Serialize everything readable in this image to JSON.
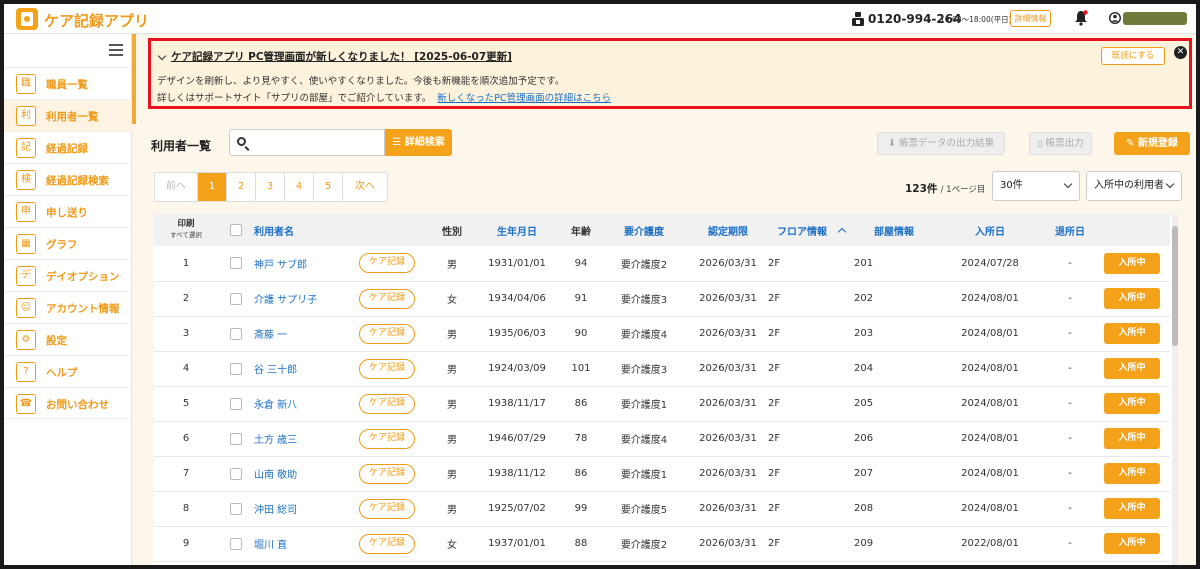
{
  "app": {
    "title": "ケア記録アプリ",
    "accent_color": "#f5a21b",
    "alert_border_color": "#e6131e"
  },
  "header": {
    "phone": "0120-994-264",
    "hours": "10:00〜18:00(平日)",
    "detail_button": "詳細情報",
    "phone_icon": "phone-icon",
    "bell_icon": "bell-icon",
    "user_icon": "user-icon"
  },
  "sidebar": {
    "items": [
      {
        "label": "職員一覧",
        "icon": "staff-icon",
        "glyph": "職"
      },
      {
        "label": "利用者一覧",
        "icon": "users-icon",
        "glyph": "利"
      },
      {
        "label": "経過記録",
        "icon": "clipboard-icon",
        "glyph": "記"
      },
      {
        "label": "経過記録検索",
        "icon": "record-search-icon",
        "glyph": "検"
      },
      {
        "label": "申し送り",
        "icon": "handover-icon",
        "glyph": "申"
      },
      {
        "label": "グラフ",
        "icon": "graph-icon",
        "glyph": "▦"
      },
      {
        "label": "デイオプション",
        "icon": "day-option-icon",
        "glyph": "デ"
      },
      {
        "label": "アカウント情報",
        "icon": "account-icon",
        "glyph": "☺"
      },
      {
        "label": "設定",
        "icon": "gear-icon",
        "glyph": "⚙"
      },
      {
        "label": "ヘルプ",
        "icon": "help-icon",
        "glyph": "?"
      },
      {
        "label": "お問い合わせ",
        "icon": "contact-icon",
        "glyph": "☎"
      }
    ]
  },
  "notice": {
    "title": "ケア記録アプリ PC管理画面が新しくなりました！ [2025-06-07更新]",
    "body1": "デザインを刷新し、より見やすく、使いやすくなりました。今後も新機能を順次追加予定です。",
    "body2": "詳しくはサポートサイト「サプリの部屋」でご紹介しています。",
    "link": "新しくなったPC管理画面の詳細はこちら",
    "read_button": "既読にする"
  },
  "main": {
    "list_title": "利用者一覧",
    "search_value": "",
    "advanced_search": "詳細検索",
    "export_results": "帳票データの出力結果",
    "output_button": "帳票出力",
    "new_button": "新規登録"
  },
  "pagination": {
    "prev": "前へ",
    "pages": [
      "1",
      "2",
      "3",
      "4",
      "5"
    ],
    "next": "次へ",
    "count": "123件",
    "page_info": "/ 1ページ目",
    "per_page": "30件",
    "status_filter": "入所中の利用者"
  },
  "table": {
    "headers": {
      "print": "印刷",
      "select_all": "すべて選択",
      "name": "利用者名",
      "gender": "性別",
      "birthdate": "生年月日",
      "age": "年齢",
      "care_level": "要介護度",
      "cert_period": "認定期限",
      "floor": "フロア情報",
      "room": "部屋情報",
      "admission": "入所日",
      "discharge": "退所日"
    },
    "care_button": "ケア記録",
    "rows": [
      {
        "no": "1",
        "name": "神戸 サブ郎",
        "gender": "男",
        "birth": "1931/01/01",
        "age": "94",
        "care": "要介護度2",
        "cert": "2026/03/31",
        "floor": "2F",
        "room": "201",
        "admit": "2024/07/28",
        "discharge": "-",
        "status": "入所中"
      },
      {
        "no": "2",
        "name": "介護 サプリ子",
        "gender": "女",
        "birth": "1934/04/06",
        "age": "91",
        "care": "要介護度3",
        "cert": "2026/03/31",
        "floor": "2F",
        "room": "202",
        "admit": "2024/08/01",
        "discharge": "-",
        "status": "入所中"
      },
      {
        "no": "3",
        "name": "斎藤 一",
        "gender": "男",
        "birth": "1935/06/03",
        "age": "90",
        "care": "要介護度4",
        "cert": "2026/03/31",
        "floor": "2F",
        "room": "203",
        "admit": "2024/08/01",
        "discharge": "-",
        "status": "入所中"
      },
      {
        "no": "4",
        "name": "谷 三十郎",
        "gender": "男",
        "birth": "1924/03/09",
        "age": "101",
        "care": "要介護度3",
        "cert": "2026/03/31",
        "floor": "2F",
        "room": "204",
        "admit": "2024/08/01",
        "discharge": "-",
        "status": "入所中"
      },
      {
        "no": "5",
        "name": "永倉 新八",
        "gender": "男",
        "birth": "1938/11/17",
        "age": "86",
        "care": "要介護度1",
        "cert": "2026/03/31",
        "floor": "2F",
        "room": "205",
        "admit": "2024/08/01",
        "discharge": "-",
        "status": "入所中"
      },
      {
        "no": "6",
        "name": "土方 歳三",
        "gender": "男",
        "birth": "1946/07/29",
        "age": "78",
        "care": "要介護度4",
        "cert": "2026/03/31",
        "floor": "2F",
        "room": "206",
        "admit": "2024/08/01",
        "discharge": "-",
        "status": "入所中"
      },
      {
        "no": "7",
        "name": "山南 敬助",
        "gender": "男",
        "birth": "1938/11/12",
        "age": "86",
        "care": "要介護度1",
        "cert": "2026/03/31",
        "floor": "2F",
        "room": "207",
        "admit": "2024/08/01",
        "discharge": "-",
        "status": "入所中"
      },
      {
        "no": "8",
        "name": "沖田 総司",
        "gender": "男",
        "birth": "1925/07/02",
        "age": "99",
        "care": "要介護度5",
        "cert": "2026/03/31",
        "floor": "2F",
        "room": "208",
        "admit": "2024/08/01",
        "discharge": "-",
        "status": "入所中"
      },
      {
        "no": "9",
        "name": "堀川 直",
        "gender": "女",
        "birth": "1937/01/01",
        "age": "88",
        "care": "要介護度2",
        "cert": "2026/03/31",
        "floor": "2F",
        "room": "209",
        "admit": "2022/08/01",
        "discharge": "-",
        "status": "入所中"
      }
    ]
  }
}
